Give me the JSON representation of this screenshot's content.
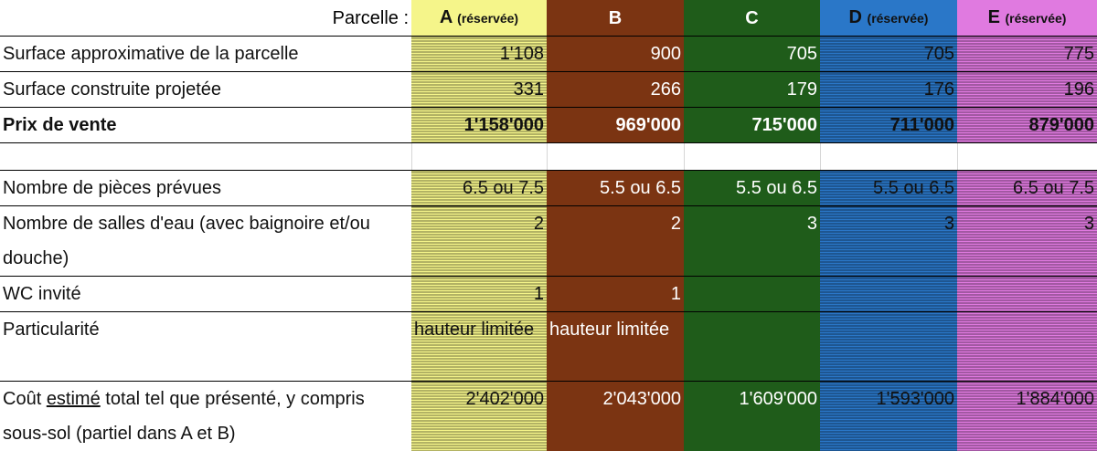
{
  "header": {
    "label": "Parcelle :",
    "parcels": [
      {
        "letter": "A",
        "note": "(réservée)"
      },
      {
        "letter": "B",
        "note": ""
      },
      {
        "letter": "C",
        "note": ""
      },
      {
        "letter": "D",
        "note": "(réservée)"
      },
      {
        "letter": "E",
        "note": "(réservée)"
      }
    ]
  },
  "rows": {
    "surface_parcelle": {
      "label": "Surface approximative de la parcelle",
      "values": [
        "1'108",
        "900",
        "705",
        "705",
        "775"
      ]
    },
    "surface_construite": {
      "label": "Surface construite projetée",
      "values": [
        "331",
        "266",
        "179",
        "176",
        "196"
      ]
    },
    "prix": {
      "label": "Prix de vente",
      "values": [
        "1'158'000",
        "969'000",
        "715'000",
        "711'000",
        "879'000"
      ]
    },
    "pieces": {
      "label": "Nombre de pièces prévues",
      "values": [
        "6.5 ou 7.5",
        "5.5 ou 6.5",
        "5.5 ou 6.5",
        "5.5 ou 6.5",
        "6.5 ou 7.5"
      ]
    },
    "salles_eau": {
      "label": "Nombre de salles d'eau (avec baignoire et/ou douche)",
      "values": [
        "2",
        "2",
        "3",
        "3",
        "3"
      ]
    },
    "wc": {
      "label": "WC invité",
      "values": [
        "1",
        "1",
        "",
        "",
        ""
      ]
    },
    "particularite": {
      "label": "Particularité",
      "values": [
        "hauteur limitée",
        "hauteur limitée",
        "",
        "",
        ""
      ]
    },
    "cout": {
      "label_before": "Coût ",
      "label_underlined": "estimé",
      "label_after": " total tel que présenté, y compris sous-sol (partiel dans A et B)",
      "values": [
        "2'402'000",
        "2'043'000",
        "1'609'000",
        "1'593'000",
        "1'884'000"
      ]
    }
  },
  "colors": {
    "A": "#f5f58a",
    "B": "#7b3412",
    "C": "#1f5c1a",
    "D": "#2a77c8",
    "E": "#e07ae0"
  }
}
